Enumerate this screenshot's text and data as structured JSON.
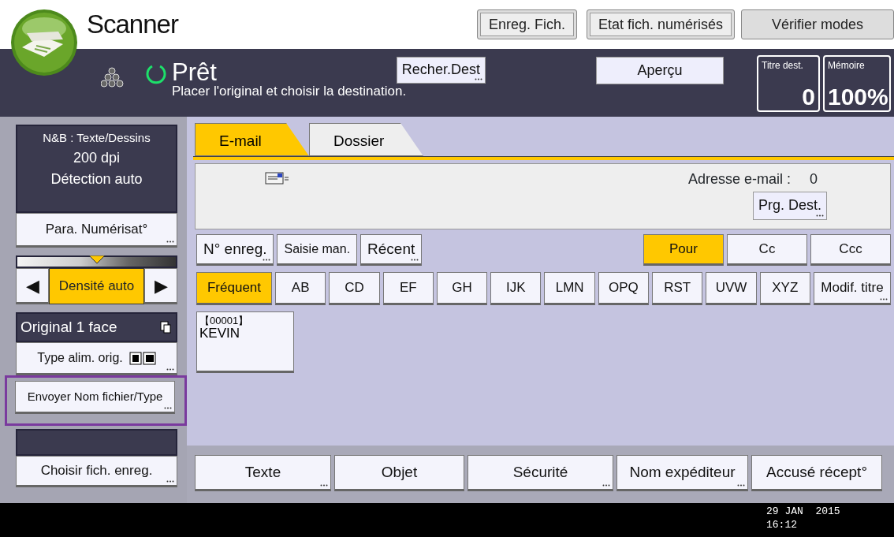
{
  "header": {
    "title": "Scanner",
    "buttons": [
      {
        "label": "Enreg. Fich.",
        "kind": "framed"
      },
      {
        "label": "Etat fich. numérisés",
        "kind": "framed"
      },
      {
        "label": "Vérifier modes",
        "kind": "plain"
      }
    ]
  },
  "status": {
    "state": "Prêt",
    "message": "Placer l'original et choisir la destination.",
    "search_button": {
      "label": "Recher.Dest",
      "more": true
    },
    "preview_button": "Aperçu",
    "counters": [
      {
        "label": "Titre dest.",
        "value": "0"
      },
      {
        "label": "Mémoire",
        "value": "100%"
      }
    ]
  },
  "left_panel": {
    "settings_summary": [
      "N&B : Texte/Dessins",
      "200 dpi",
      "Détection auto"
    ],
    "scan_settings_button": {
      "label": "Para. Numérisat°",
      "more": true
    },
    "density": {
      "level": 0.5,
      "label": "Densité auto",
      "left_arrow": "◀",
      "right_arrow": "▶"
    },
    "original": "Original 1 face",
    "feed_button": {
      "label": "Type alim. orig.",
      "more": true
    },
    "filename_button": {
      "label": "Envoyer Nom fichier/Type",
      "more": true,
      "highlighted": true
    },
    "store_button": {
      "label": "Choisir fich. enreg.",
      "more": true
    }
  },
  "tabs": [
    {
      "label": "E-mail",
      "selected": true
    },
    {
      "label": "Dossier",
      "selected": false
    }
  ],
  "destination_info": {
    "address_label": "Adresse e-mail :",
    "address_count": "0",
    "program_button": {
      "label": "Prg. Dest.",
      "more": true
    }
  },
  "entry_buttons": [
    {
      "label": "N° enreg.",
      "more": true
    },
    {
      "label": "Saisie man.",
      "more": false
    },
    {
      "label": "Récent",
      "more": true
    }
  ],
  "recipient_types": [
    {
      "label": "Pour",
      "selected": true
    },
    {
      "label": "Cc",
      "selected": false
    },
    {
      "label": "Ccc",
      "selected": false
    }
  ],
  "index_tabs": [
    {
      "label": "Fréquent",
      "selected": true
    },
    {
      "label": "AB",
      "selected": false
    },
    {
      "label": "CD",
      "selected": false
    },
    {
      "label": "EF",
      "selected": false
    },
    {
      "label": "GH",
      "selected": false
    },
    {
      "label": "IJK",
      "selected": false
    },
    {
      "label": "LMN",
      "selected": false
    },
    {
      "label": "OPQ",
      "selected": false
    },
    {
      "label": "RST",
      "selected": false
    },
    {
      "label": "UVW",
      "selected": false
    },
    {
      "label": "XYZ",
      "selected": false
    }
  ],
  "title_button": {
    "label": "Modif. titre",
    "more": true
  },
  "destinations": [
    {
      "number": "【00001】",
      "name": "KEVIN"
    }
  ],
  "options": [
    {
      "label": "Texte",
      "more": true
    },
    {
      "label": "Objet",
      "more": false
    },
    {
      "label": "Sécurité",
      "more": true
    },
    {
      "label": "Nom expéditeur",
      "more": true
    },
    {
      "label": "Accusé récept°",
      "more": false
    }
  ],
  "clock": {
    "date": "29 JAN  2015",
    "time": "16:12"
  }
}
